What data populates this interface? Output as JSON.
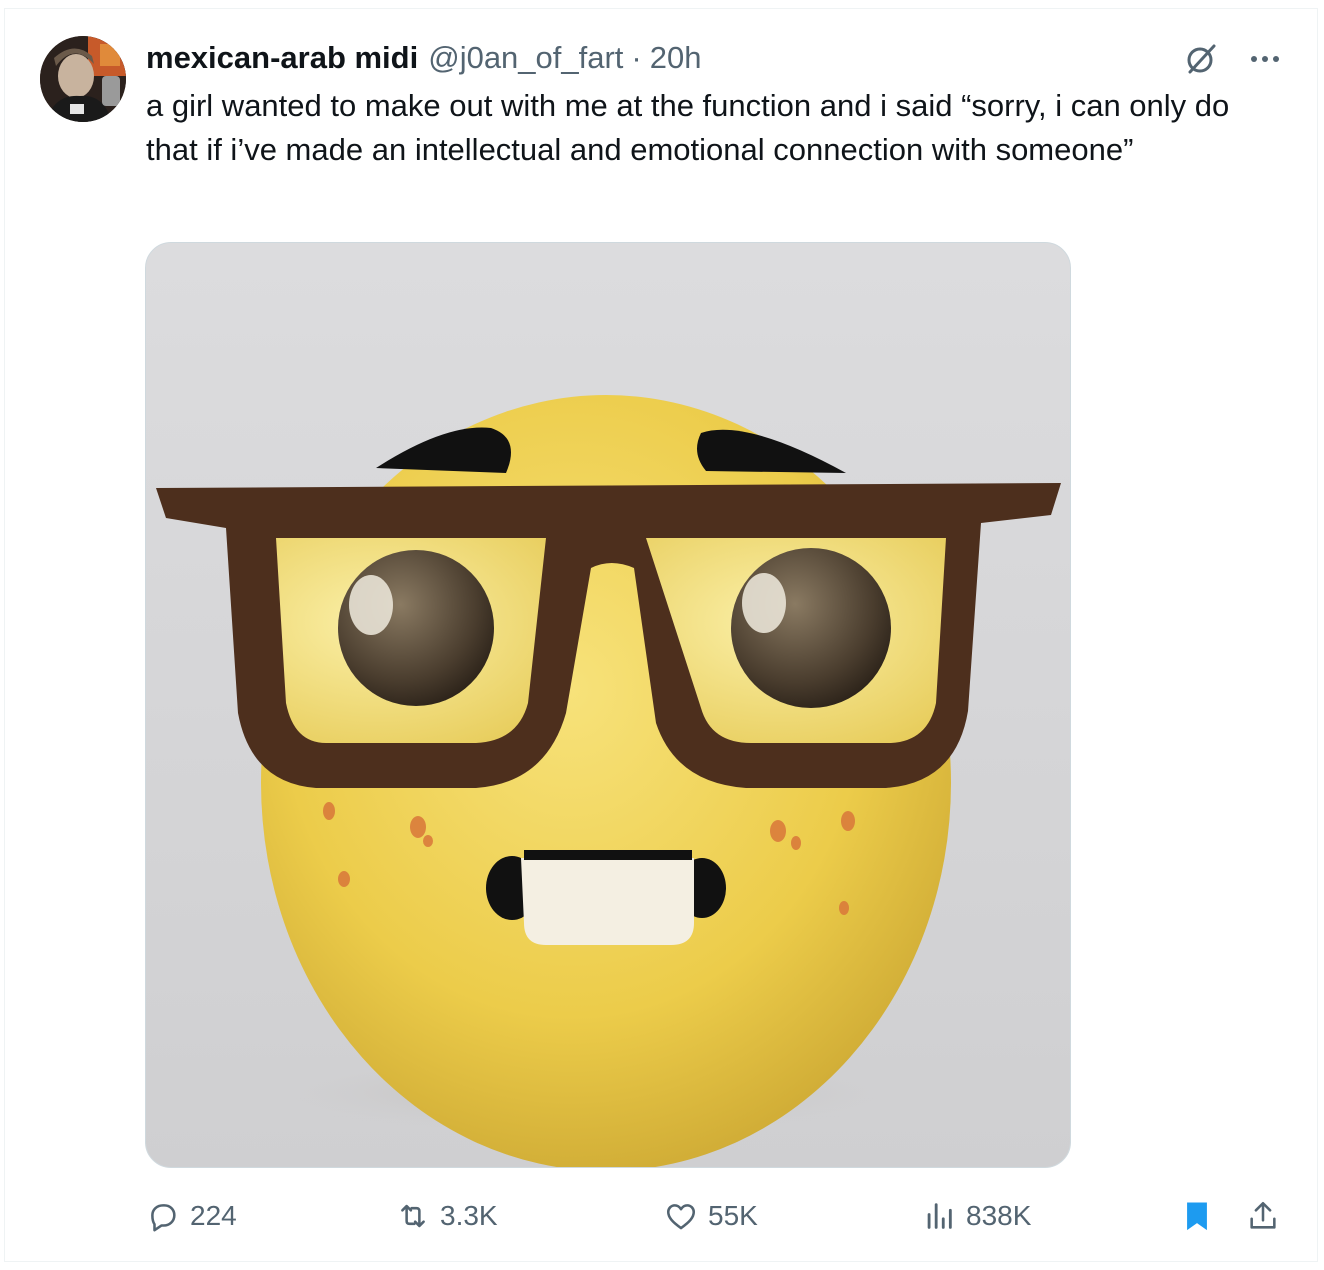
{
  "tweet": {
    "author": {
      "display_name": "mexican-arab midi",
      "handle": "@j0an_of_fart",
      "separator": "·",
      "time": "20h",
      "avatar_icon": "user-avatar-photo"
    },
    "text": "a girl wanted to make out with me at the function and i said “sorry, i can only do that if i’ve made an intellectual and emotional connection with someone”",
    "media": {
      "type": "image",
      "depicts": "nerd-face-emoji-icon"
    },
    "header_icons": {
      "grok": "grok-icon",
      "more": "more-icon"
    },
    "stats": {
      "replies": "224",
      "reposts": "3.3K",
      "likes": "55K",
      "views": "838K"
    },
    "icons": {
      "reply": "reply-icon",
      "repost": "repost-icon",
      "like": "heart-icon",
      "views": "views-icon",
      "bookmark": "bookmark-icon",
      "share": "share-icon"
    },
    "colors": {
      "text_primary": "#0f1419",
      "text_secondary": "#536471",
      "bookmark_active": "#1d9bf0",
      "border": "#cfd9de"
    }
  }
}
